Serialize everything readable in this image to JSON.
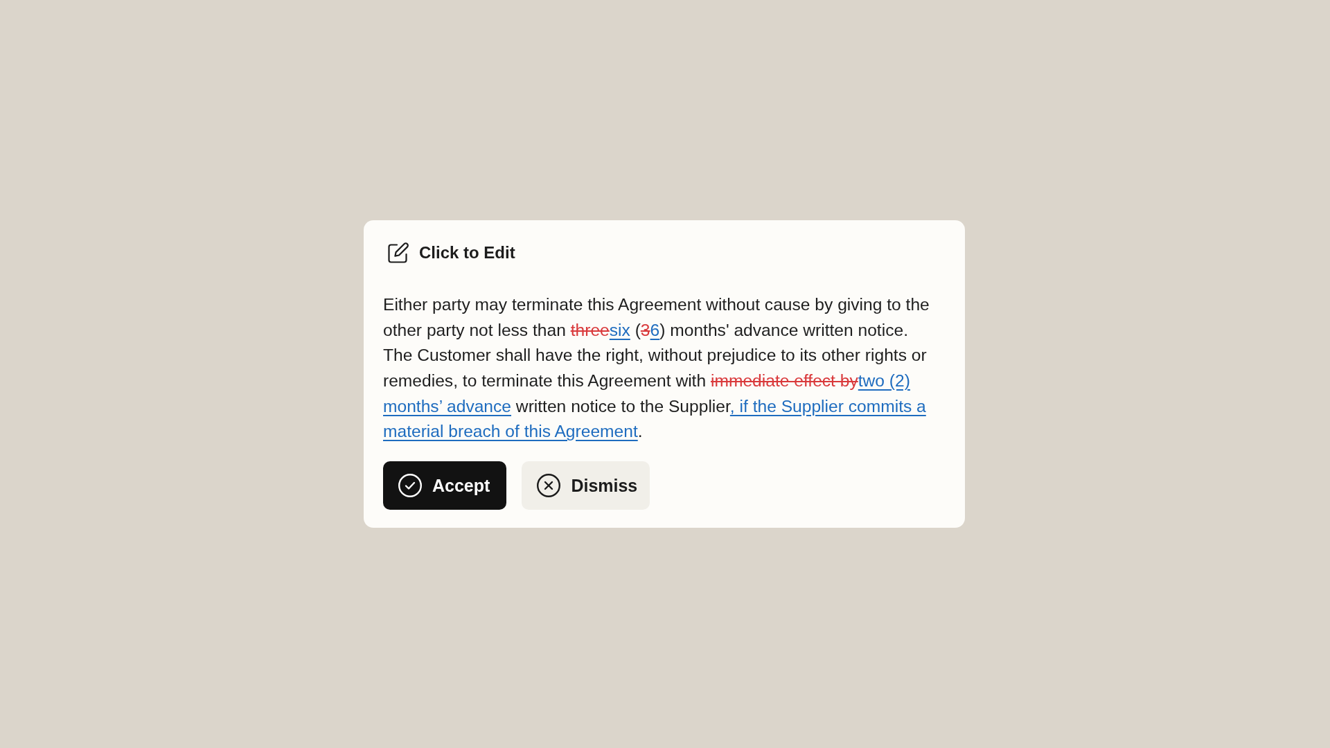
{
  "header": {
    "title": "Click to Edit"
  },
  "suggestion": {
    "segments": [
      {
        "kind": "text",
        "text": "Either party may terminate this Agreement without cause by giving to the other party not less than "
      },
      {
        "kind": "deleted",
        "text": "three"
      },
      {
        "kind": "inserted",
        "text": "six"
      },
      {
        "kind": "text",
        "text": " ("
      },
      {
        "kind": "deleted",
        "text": "3"
      },
      {
        "kind": "inserted",
        "text": "6"
      },
      {
        "kind": "text",
        "text": ") months' advance written notice. The Customer shall have the right, without prejudice to its other rights or remedies, to terminate this Agreement with "
      },
      {
        "kind": "deleted",
        "text": "immediate effect by"
      },
      {
        "kind": "inserted",
        "text": "two (2) months’ advance"
      },
      {
        "kind": "text",
        "text": " written notice to the Supplier"
      },
      {
        "kind": "inserted",
        "text": ", if the Supplier commits a material breach of this Agreement"
      },
      {
        "kind": "text",
        "text": "."
      }
    ]
  },
  "buttons": [
    {
      "kind": "accept",
      "label": "Accept"
    },
    {
      "kind": "dismiss",
      "label": "Dismiss"
    }
  ]
}
